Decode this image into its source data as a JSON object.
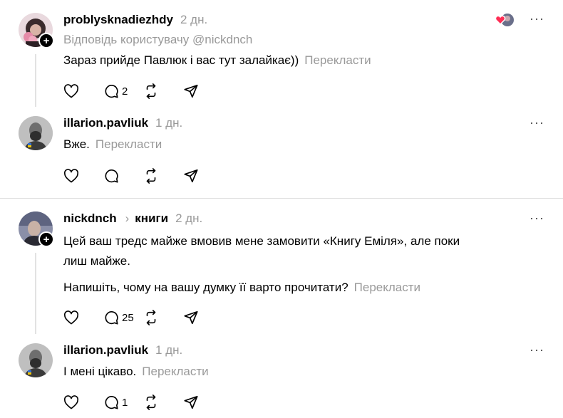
{
  "posts": [
    {
      "username": "problysknadiezhdy",
      "time": "2 дн.",
      "reply_to": "Відповідь користувачу @nickdnch",
      "text": "Зараз прийде Павлюк і вас тут залайкає))",
      "translate": "Перекласти",
      "replies": "2",
      "more": "···"
    },
    {
      "username": "illarion.pavliuk",
      "time": "1 дн.",
      "text": "Вже.",
      "translate": "Перекласти",
      "more": "···"
    },
    {
      "username": "nickdnch",
      "topic": "книги",
      "time": "2 дн.",
      "text_line1": "Цей ваш тредс майже вмовив мене замовити «Книгу Еміля», але поки",
      "text_line2": "лиш майже.",
      "text_para2": "Напишіть, чому на вашу думку її варто прочитати?",
      "translate": "Перекласти",
      "replies": "25",
      "more": "···"
    },
    {
      "username": "illarion.pavliuk",
      "time": "1 дн.",
      "text": "І мені цікаво.",
      "translate": "Перекласти",
      "replies": "1",
      "more": "···"
    }
  ],
  "icons": [
    "heart-icon",
    "comment-icon",
    "repost-icon",
    "share-icon",
    "more-icon",
    "plus-icon",
    "chevron-right-icon"
  ]
}
